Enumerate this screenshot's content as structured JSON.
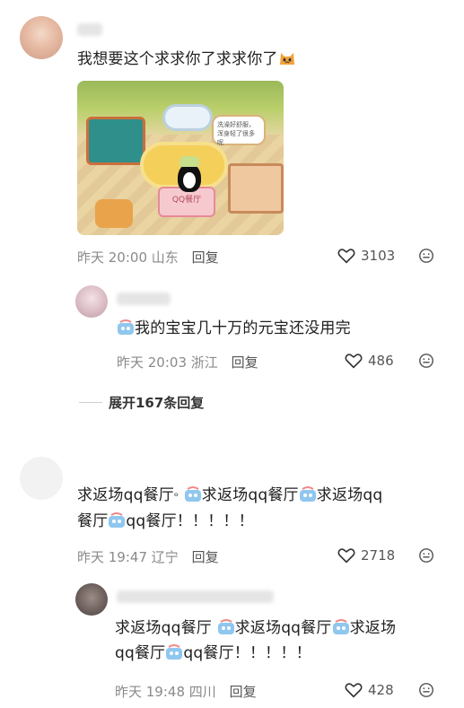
{
  "comments": [
    {
      "text": "我想要这个求求你了求求你了",
      "emoji_tail": "angry-cat-emoji",
      "image": {
        "bubble_text": "洗澡好舒服，浑身轻了很多呢",
        "sign_text": "QQ餐厅"
      },
      "time": "昨天 20:00",
      "location": "山东",
      "reply_label": "回复",
      "likes": "3103",
      "reply": {
        "text": "我的宝宝几十万的元宝还没用完",
        "time": "昨天 20:03",
        "location": "浙江",
        "reply_label": "回复",
        "likes": "486"
      },
      "expand_label": "展开167条回复"
    },
    {
      "text_line1_a": "求返场qq餐厅",
      "text_line1_b": "求返场qq餐厅",
      "text_line1_c": "求返场qq",
      "text_line2_a": "餐厅",
      "text_line2_b": "qq餐厅！！！！！",
      "time": "昨天 19:47",
      "location": "辽宁",
      "reply_label": "回复",
      "likes": "2718",
      "reply": {
        "text_line1_a": "求返场qq餐厅 ",
        "text_line1_b": "求返场qq餐厅",
        "text_line1_c": "求返场",
        "text_line2_a": "qq餐厅",
        "text_line2_b": "qq餐厅！！！！！",
        "time": "昨天 19:48",
        "location": "四川",
        "reply_label": "回复",
        "likes": "428"
      }
    }
  ]
}
